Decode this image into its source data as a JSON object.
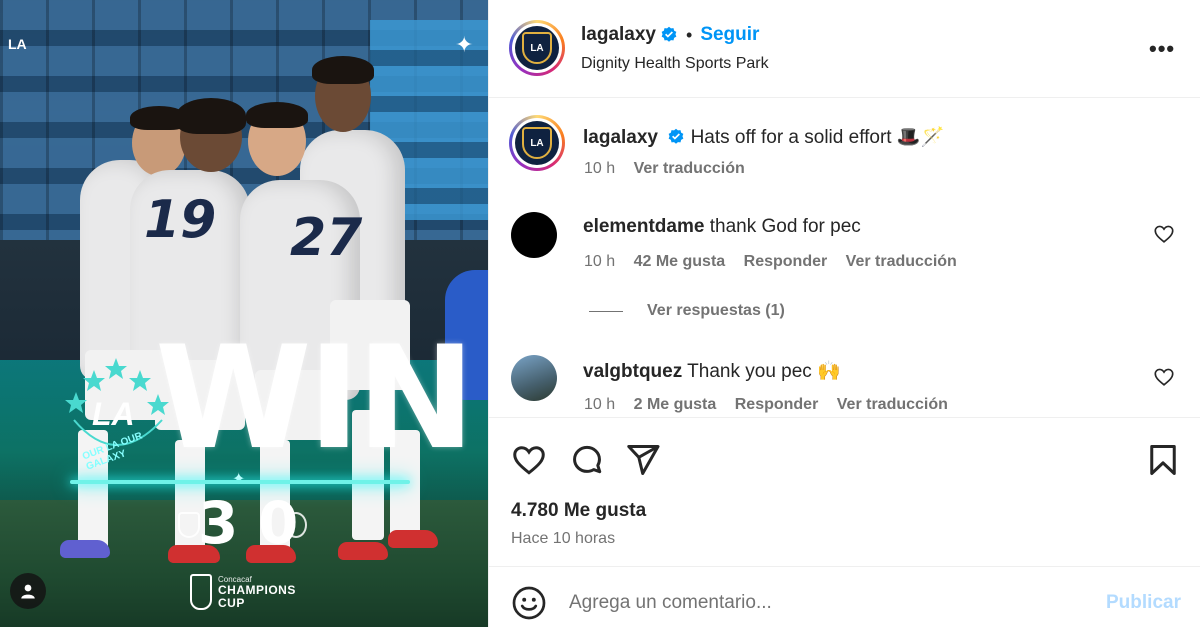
{
  "post": {
    "username": "lagalaxy",
    "follow_label": "Seguir",
    "separator": "•",
    "location": "Dignity Health Sports Park",
    "more_label": "•••"
  },
  "image": {
    "corner_logo": "LA",
    "win_text": "WIN",
    "badge_text": "LA",
    "badge_tagline": "OUR LA OUR GALAXY",
    "score_home": "3",
    "score_away": "0",
    "competition_top": "Concacaf",
    "competition_main_1": "CHAMPIONS",
    "competition_main_2": "CUP",
    "jersey_a": "19",
    "jersey_b": "27"
  },
  "caption": {
    "username": "lagalaxy",
    "text": "Hats off for a solid effort 🎩🪄",
    "time": "10 h",
    "translate": "Ver traducción"
  },
  "comments": [
    {
      "username": "elementdame",
      "text": "thank God for pec",
      "time": "10 h",
      "likes": "42 Me gusta",
      "reply": "Responder",
      "translate": "Ver traducción"
    },
    {
      "username": "valgbtquez",
      "text": "Thank you pec 🙌",
      "time": "10 h",
      "likes": "2 Me gusta",
      "reply": "Responder",
      "translate": "Ver traducción"
    }
  ],
  "view_replies": "Ver respuestas (1)",
  "stats": {
    "likes": "4.780 Me gusta",
    "time_ago": "Hace 10 horas"
  },
  "comment_box": {
    "placeholder": "Agrega un comentario...",
    "publish_label": "Publicar"
  },
  "colors": {
    "accent": "#0095f6",
    "verified": "#0095f6",
    "muted": "#737373",
    "publish_disabled": "#b3dbff"
  }
}
